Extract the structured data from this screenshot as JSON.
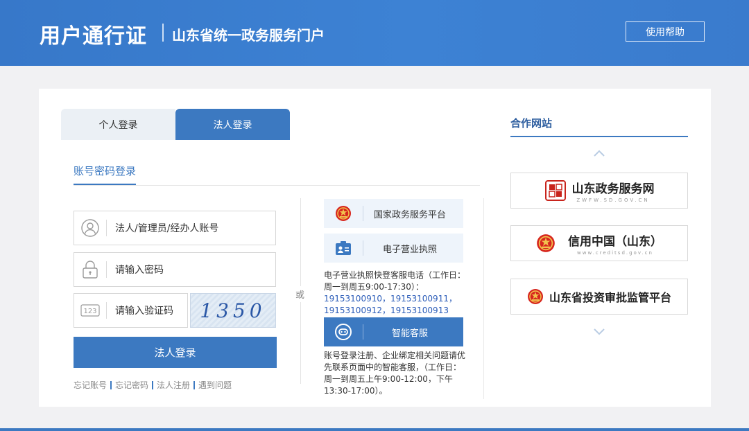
{
  "header": {
    "title": "用户通行证",
    "subtitle": "山东省统一政务服务门户",
    "help_label": "使用帮助"
  },
  "tabs": {
    "personal": "个人登录",
    "corporate": "法人登录"
  },
  "login": {
    "mode_label": "账号密码登录",
    "account_placeholder": "法人/管理员/经办人账号",
    "password_placeholder": "请输入密码",
    "code_placeholder": "请输入验证码",
    "captcha_text": "1350",
    "submit_label": "法人登录",
    "links": [
      "忘记账号",
      "忘记密码",
      "法人注册",
      "遇到问题"
    ],
    "or_label": "或"
  },
  "services": {
    "gov_platform": "国家政务服务平台",
    "e_license": "电子营业执照",
    "license_info_line1": "电子营业执照快登客服电话（工作日：",
    "license_info_line2": "周一到周五9:00-17:30）：",
    "phone_line1": "19153100910，19153100911，",
    "phone_line2": "19153100912，19153100913",
    "ai_service": "智能客服",
    "ai_info_line1": "账号登录注册、企业绑定相关问题请优",
    "ai_info_line2": "先联系页面中的智能客服，（工作日：",
    "ai_info_line3": "周一到周五上午9:00-12:00，下午",
    "ai_info_line4": "13:30-17:00）。"
  },
  "partners": {
    "title": "合作网站",
    "items": [
      {
        "name": "山东政务服务网",
        "sub": "ZWFW.SD.GOV.CN"
      },
      {
        "name": "信用中国（山东）",
        "sub": "www.creditsd.gov.cn"
      },
      {
        "name": "山东省投资审批监管平台",
        "sub": ""
      }
    ]
  },
  "colors": {
    "primary": "#3c79c1",
    "header_bg": "#3d82d4",
    "emblem_red": "#d7261e",
    "emblem_gold": "#f2c14e"
  },
  "icons": {
    "account": "user-icon",
    "password": "lock-icon",
    "code": "numeric-123-icon",
    "gov": "national-emblem-icon",
    "license": "id-card-icon",
    "ai": "chat-robot-icon",
    "scroll_up": "chevron-up-icon",
    "scroll_down": "chevron-down-icon"
  }
}
